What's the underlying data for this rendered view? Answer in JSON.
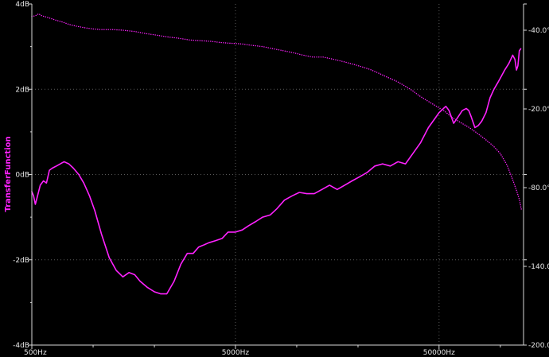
{
  "chart_data": {
    "type": "line",
    "title": "",
    "xlabel": "",
    "ylabel": "TransferFunction",
    "xscale": "log",
    "xlim": [
      500,
      130000
    ],
    "ylim": [
      -4,
      4
    ],
    "y2lim": [
      -200,
      60
    ],
    "grid": true,
    "x_ticks": [
      "500Hz",
      "5000Hz",
      "50000Hz"
    ],
    "y_ticks": [
      "4dB",
      "2dB",
      "0dB",
      "-2dB",
      "-4dB"
    ],
    "y2_ticks": [
      "-40.0°",
      "-20.0°",
      "-80.0°",
      "-140.0°",
      "-200.0°"
    ],
    "colors": {
      "background": "#000000",
      "axis": "#d8d8d8",
      "grid": "#5a5a5a",
      "series": "#ff22ff"
    },
    "series": [
      {
        "axis": "left",
        "style": "solid",
        "x": [
          500,
          510,
          520,
          530,
          550,
          570,
          590,
          610,
          630,
          660,
          690,
          720,
          760,
          800,
          850,
          900,
          960,
          1020,
          1100,
          1200,
          1300,
          1400,
          1500,
          1600,
          1700,
          1850,
          2000,
          2150,
          2300,
          2500,
          2700,
          2900,
          3100,
          3300,
          3500,
          3700,
          4000,
          4300,
          4600,
          5000,
          5400,
          5800,
          6300,
          6800,
          7400,
          8000,
          8700,
          9500,
          10300,
          11200,
          12200,
          13300,
          14500,
          15800,
          17200,
          18700,
          20400,
          22200,
          24200,
          26400,
          28800,
          31400,
          34200,
          37300,
          40600,
          44300,
          48300,
          50000,
          52600,
          54000,
          56000,
          59000,
          62000,
          65000,
          68000,
          70000,
          72000,
          75000,
          78000,
          81000,
          85000,
          89000,
          93000,
          97000,
          101000,
          105000,
          110000,
          115000,
          118000,
          120000,
          122000,
          124000,
          126000
        ],
        "y": [
          -0.4,
          -0.5,
          -0.7,
          -0.55,
          -0.25,
          -0.15,
          -0.2,
          0.1,
          0.15,
          0.2,
          0.25,
          0.3,
          0.25,
          0.15,
          0.0,
          -0.2,
          -0.5,
          -0.85,
          -1.4,
          -1.95,
          -2.25,
          -2.4,
          -2.3,
          -2.35,
          -2.5,
          -2.65,
          -2.75,
          -2.8,
          -2.8,
          -2.5,
          -2.1,
          -1.85,
          -1.85,
          -1.7,
          -1.65,
          -1.6,
          -1.55,
          -1.5,
          -1.35,
          -1.35,
          -1.3,
          -1.2,
          -1.1,
          -1.0,
          -0.95,
          -0.8,
          -0.6,
          -0.5,
          -0.42,
          -0.45,
          -0.45,
          -0.35,
          -0.25,
          -0.35,
          -0.25,
          -0.15,
          -0.05,
          0.05,
          0.2,
          0.25,
          0.2,
          0.3,
          0.25,
          0.5,
          0.75,
          1.1,
          1.35,
          1.45,
          1.55,
          1.6,
          1.5,
          1.2,
          1.35,
          1.5,
          1.55,
          1.5,
          1.35,
          1.1,
          1.15,
          1.25,
          1.45,
          1.8,
          2.0,
          2.15,
          2.3,
          2.45,
          2.6,
          2.8,
          2.7,
          2.45,
          2.55,
          2.9,
          2.95
        ]
      },
      {
        "axis": "right",
        "style": "dotted",
        "x": [
          500,
          520,
          540,
          560,
          590,
          620,
          660,
          700,
          760,
          830,
          900,
          1000,
          1100,
          1250,
          1400,
          1600,
          1800,
          2000,
          2300,
          2600,
          3000,
          3400,
          3800,
          4300,
          4800,
          5400,
          6000,
          6800,
          7600,
          8500,
          9500,
          10700,
          12000,
          13500,
          15000,
          17000,
          19000,
          21000,
          23000,
          25500,
          28000,
          31000,
          34000,
          37000,
          40000,
          44000,
          48000,
          53000,
          58000,
          64000,
          70000,
          77000,
          84000,
          92000,
          100000,
          108000,
          115000,
          120000,
          124000,
          127000
        ],
        "y": [
          50.5,
          51,
          52.5,
          51,
          50,
          49,
          47.5,
          46.5,
          44.5,
          43,
          42,
          41,
          40.5,
          40.5,
          40,
          39,
          37.5,
          36.5,
          35,
          34,
          32.5,
          32,
          31.5,
          30.5,
          30,
          29.5,
          28.5,
          27.5,
          26,
          24.5,
          23,
          21,
          19.5,
          19.5,
          18,
          16,
          14,
          12,
          10,
          7,
          4,
          1,
          -2.5,
          -6,
          -10,
          -14,
          -17.5,
          -21.5,
          -26.5,
          -30.5,
          -34,
          -38.5,
          -43,
          -48,
          -54,
          -63,
          -74,
          -82,
          -89,
          -97
        ]
      }
    ]
  }
}
